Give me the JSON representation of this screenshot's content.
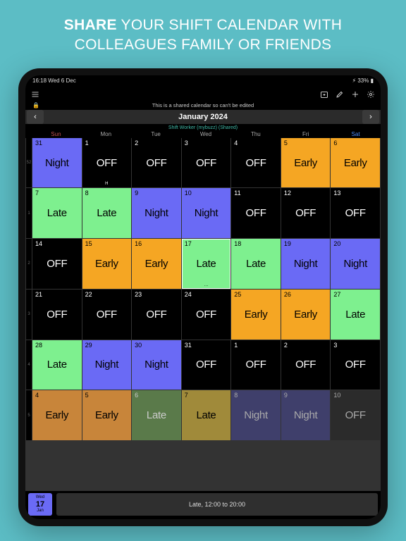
{
  "marketing": {
    "headline_bold": "SHARE",
    "headline_rest": " YOUR SHIFT CALENDAR WITH COLLEAGUES FAMILY OR FRIENDS"
  },
  "status": {
    "time": "16:18",
    "date": "Wed 6 Dec",
    "battery": "33%"
  },
  "lock_note": "This is a shared calendar so can't be edited",
  "month_label": "January 2024",
  "shared_label": "Shift Worker (mybuzz) (Shared)",
  "dows": [
    "Sun",
    "Mon",
    "Tue",
    "Wed",
    "Thu",
    "Fri",
    "Sat"
  ],
  "weeks": [
    {
      "wk": "52",
      "days": [
        {
          "n": "31",
          "t": "Night",
          "c": "c-night"
        },
        {
          "n": "1",
          "t": "OFF",
          "c": "c-off",
          "dot": "H"
        },
        {
          "n": "2",
          "t": "OFF",
          "c": "c-off"
        },
        {
          "n": "3",
          "t": "OFF",
          "c": "c-off"
        },
        {
          "n": "4",
          "t": "OFF",
          "c": "c-off"
        },
        {
          "n": "5",
          "t": "Early",
          "c": "c-early"
        },
        {
          "n": "6",
          "t": "Early",
          "c": "c-early"
        }
      ]
    },
    {
      "wk": "1",
      "days": [
        {
          "n": "7",
          "t": "Late",
          "c": "c-late"
        },
        {
          "n": "8",
          "t": "Late",
          "c": "c-late"
        },
        {
          "n": "9",
          "t": "Night",
          "c": "c-night"
        },
        {
          "n": "10",
          "t": "Night",
          "c": "c-night"
        },
        {
          "n": "11",
          "t": "OFF",
          "c": "c-off"
        },
        {
          "n": "12",
          "t": "OFF",
          "c": "c-off"
        },
        {
          "n": "13",
          "t": "OFF",
          "c": "c-off"
        }
      ]
    },
    {
      "wk": "2",
      "days": [
        {
          "n": "14",
          "t": "OFF",
          "c": "c-off"
        },
        {
          "n": "15",
          "t": "Early",
          "c": "c-early"
        },
        {
          "n": "16",
          "t": "Early",
          "c": "c-early"
        },
        {
          "n": "17",
          "t": "Late",
          "c": "c-late",
          "sel": true,
          "dot": "…"
        },
        {
          "n": "18",
          "t": "Late",
          "c": "c-late"
        },
        {
          "n": "19",
          "t": "Night",
          "c": "c-night"
        },
        {
          "n": "20",
          "t": "Night",
          "c": "c-night"
        }
      ]
    },
    {
      "wk": "3",
      "days": [
        {
          "n": "21",
          "t": "OFF",
          "c": "c-off"
        },
        {
          "n": "22",
          "t": "OFF",
          "c": "c-off"
        },
        {
          "n": "23",
          "t": "OFF",
          "c": "c-off"
        },
        {
          "n": "24",
          "t": "OFF",
          "c": "c-off"
        },
        {
          "n": "25",
          "t": "Early",
          "c": "c-early"
        },
        {
          "n": "26",
          "t": "Early",
          "c": "c-early"
        },
        {
          "n": "27",
          "t": "Late",
          "c": "c-late"
        }
      ]
    },
    {
      "wk": "4",
      "days": [
        {
          "n": "28",
          "t": "Late",
          "c": "c-late"
        },
        {
          "n": "29",
          "t": "Night",
          "c": "c-night"
        },
        {
          "n": "30",
          "t": "Night",
          "c": "c-night"
        },
        {
          "n": "31",
          "t": "OFF",
          "c": "c-off"
        },
        {
          "n": "1",
          "t": "OFF",
          "c": "c-off"
        },
        {
          "n": "2",
          "t": "OFF",
          "c": "c-off"
        },
        {
          "n": "3",
          "t": "OFF",
          "c": "c-off"
        }
      ]
    },
    {
      "wk": "5",
      "days": [
        {
          "n": "4",
          "t": "Early",
          "c": "c-early2"
        },
        {
          "n": "5",
          "t": "Early",
          "c": "c-early2"
        },
        {
          "n": "6",
          "t": "Late",
          "c": "c-late3"
        },
        {
          "n": "7",
          "t": "Late",
          "c": "c-late2"
        },
        {
          "n": "8",
          "t": "Night",
          "c": "c-night2"
        },
        {
          "n": "9",
          "t": "Night",
          "c": "c-night2"
        },
        {
          "n": "10",
          "t": "OFF",
          "c": "c-off2"
        }
      ]
    }
  ],
  "badge": {
    "dow": "Wed",
    "num": "17",
    "mon": "Jan"
  },
  "summary": "Late, 12:00 to 20:00"
}
